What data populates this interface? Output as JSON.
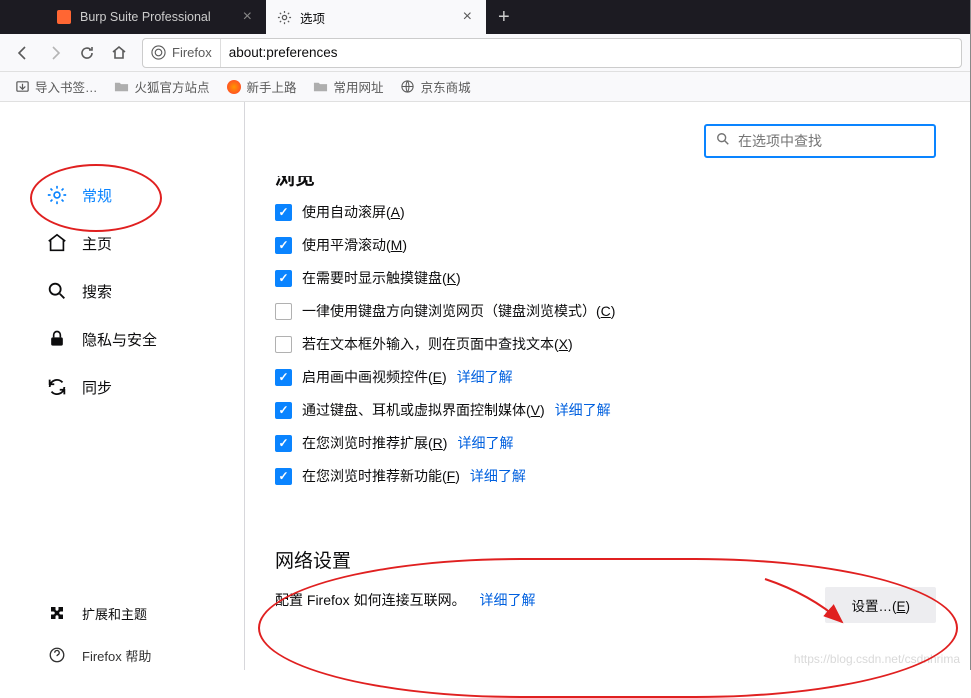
{
  "tabs": {
    "items": [
      {
        "title": "Burp Suite Professional",
        "favicon_color": "#ff6633"
      },
      {
        "title": "选项",
        "favicon": "gear"
      }
    ],
    "active_index": 1
  },
  "urlbar": {
    "identity": "Firefox",
    "url": "about:preferences"
  },
  "bookmarks": {
    "import_label": "导入书签…",
    "items": [
      {
        "label": "火狐官方站点",
        "icon": "folder"
      },
      {
        "label": "新手上路",
        "icon": "firefox"
      },
      {
        "label": "常用网址",
        "icon": "folder"
      },
      {
        "label": "京东商城",
        "icon": "globe"
      }
    ]
  },
  "sidebar": {
    "items": [
      {
        "label": "常规",
        "icon": "gear"
      },
      {
        "label": "主页",
        "icon": "home"
      },
      {
        "label": "搜索",
        "icon": "search"
      },
      {
        "label": "隐私与安全",
        "icon": "lock"
      },
      {
        "label": "同步",
        "icon": "sync"
      }
    ],
    "selected_index": 0,
    "addons": "扩展和主题",
    "help": "Firefox 帮助"
  },
  "search": {
    "placeholder": "在选项中查找"
  },
  "browsing": {
    "title": "浏览",
    "rows": [
      {
        "checked": true,
        "label_pre": "使用自动滚屏(",
        "accel": "A",
        "label_post": ")"
      },
      {
        "checked": true,
        "label_pre": "使用平滑滚动(",
        "accel": "M",
        "label_post": ")"
      },
      {
        "checked": true,
        "label_pre": "在需要时显示触摸键盘(",
        "accel": "K",
        "label_post": ")"
      },
      {
        "checked": false,
        "label_pre": "一律使用键盘方向键浏览网页（键盘浏览模式）(",
        "accel": "C",
        "label_post": ")"
      },
      {
        "checked": false,
        "label_pre": "若在文本框外输入，则在页面中查找文本(",
        "accel": "X",
        "label_post": ")"
      },
      {
        "checked": true,
        "label_pre": "启用画中画视频控件(",
        "accel": "E",
        "label_post": ")",
        "link": "详细了解"
      },
      {
        "checked": true,
        "label_pre": "通过键盘、耳机或虚拟界面控制媒体(",
        "accel": "V",
        "label_post": ")",
        "link": "详细了解"
      },
      {
        "checked": true,
        "label_pre": "在您浏览时推荐扩展(",
        "accel": "R",
        "label_post": ")",
        "link": "详细了解"
      },
      {
        "checked": true,
        "label_pre": "在您浏览时推荐新功能(",
        "accel": "F",
        "label_post": ")",
        "link": "详细了解"
      }
    ]
  },
  "network": {
    "title": "网络设置",
    "desc_pre": "配置 Firefox 如何连接互联网。",
    "link": "详细了解",
    "button": "设置…(",
    "button_accel": "E",
    "button_post": ")"
  },
  "watermark": "https://blog.csdn.net/csdnhrima"
}
